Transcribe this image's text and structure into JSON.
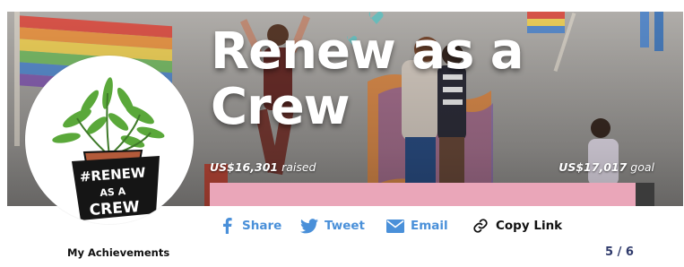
{
  "campaign": {
    "title": "Renew as a Crew",
    "raised_amount": "US$16,301",
    "raised_suffix": " raised",
    "goal_amount": "US$17,017",
    "goal_suffix": " goal",
    "progress_fraction": 0.958,
    "colors": {
      "progress_fill": "#eaa6b9",
      "progress_track": "#3b3b3b",
      "share_blue": "#4a90d9",
      "count_navy": "#2f3a6b"
    }
  },
  "avatar": {
    "logo_lines": [
      "#RENEW",
      "AS A",
      "CREW"
    ]
  },
  "share": {
    "items": [
      {
        "label": "Share",
        "icon": "facebook-icon"
      },
      {
        "label": "Tweet",
        "icon": "twitter-icon"
      },
      {
        "label": "Email",
        "icon": "email-icon"
      },
      {
        "label": "Copy Link",
        "icon": "link-icon"
      }
    ]
  },
  "achievements": {
    "label": "My Achievements",
    "count": "5 / 6"
  }
}
